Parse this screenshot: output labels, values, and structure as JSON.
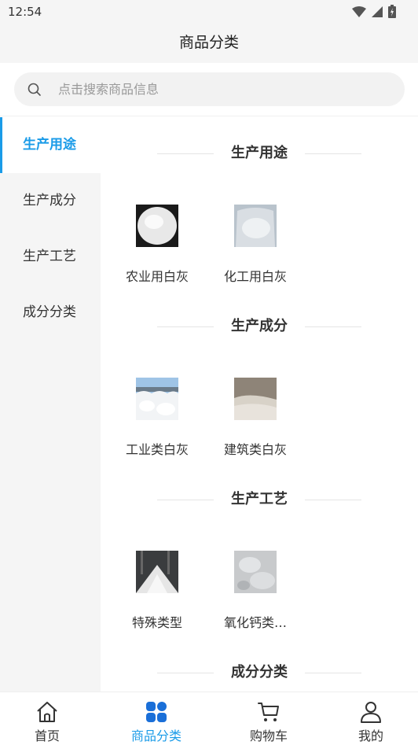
{
  "status_bar": {
    "time": "12:54"
  },
  "header": {
    "title": "商品分类"
  },
  "search": {
    "placeholder": "点击搜索商品信息"
  },
  "sidebar": {
    "items": [
      {
        "label": "生产用途",
        "active": true
      },
      {
        "label": "生产成分",
        "active": false
      },
      {
        "label": "生产工艺",
        "active": false
      },
      {
        "label": "成分分类",
        "active": false
      }
    ]
  },
  "sections": [
    {
      "title": "生产用途",
      "products": [
        {
          "name": "农业用白灰"
        },
        {
          "name": "化工用白灰"
        }
      ]
    },
    {
      "title": "生产成分",
      "products": [
        {
          "name": "工业类白灰"
        },
        {
          "name": "建筑类白灰"
        }
      ]
    },
    {
      "title": "生产工艺",
      "products": [
        {
          "name": "特殊类型"
        },
        {
          "name": "氧化钙类…"
        }
      ]
    },
    {
      "title": "成分分类",
      "products": []
    }
  ],
  "tabbar": {
    "items": [
      {
        "label": "首页",
        "icon": "home-icon"
      },
      {
        "label": "商品分类",
        "icon": "category-icon",
        "active": true
      },
      {
        "label": "购物车",
        "icon": "cart-icon"
      },
      {
        "label": "我的",
        "icon": "user-icon"
      }
    ]
  },
  "colors": {
    "accent": "#1a9be8",
    "sidebar_bg": "#f5f5f5"
  }
}
